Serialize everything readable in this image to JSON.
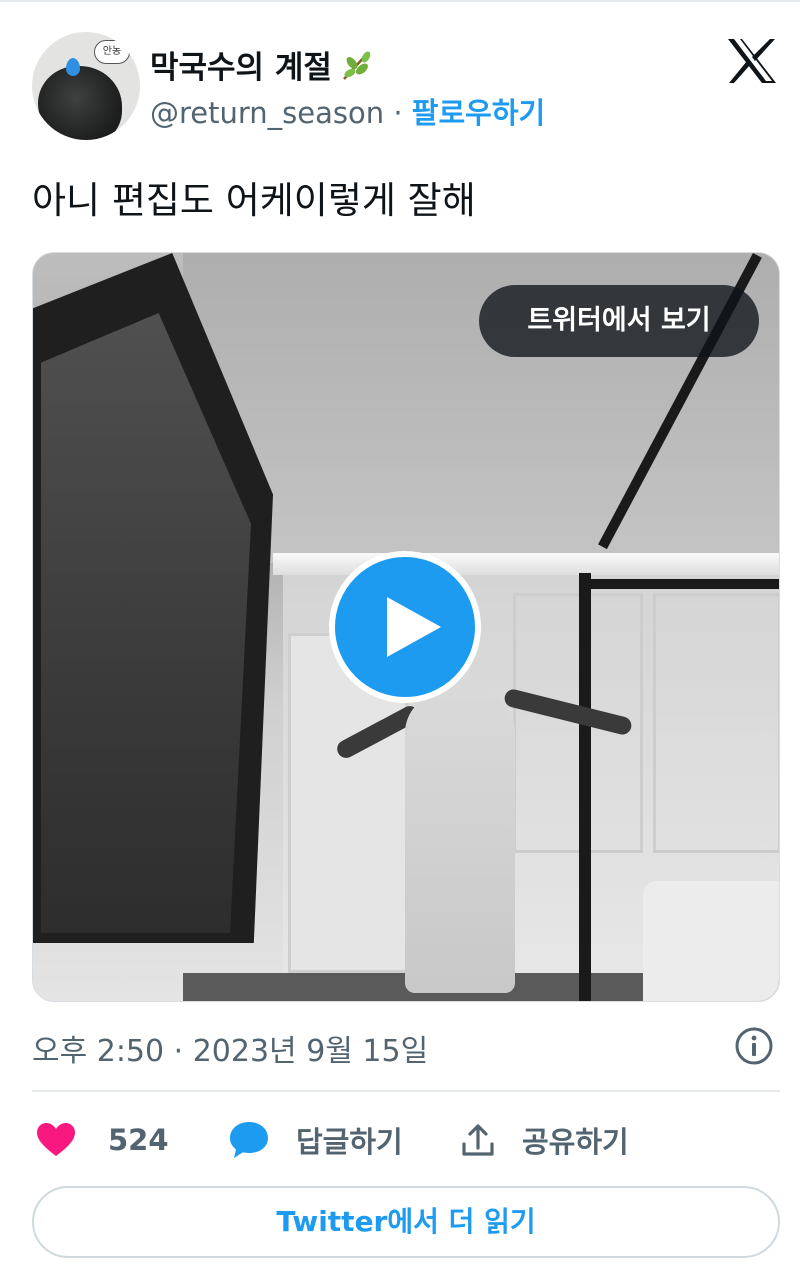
{
  "header": {
    "avatar_bubble_text": "안농",
    "display_name": "막국수의 계절",
    "name_emoji_icon": "leaf-branch-icon",
    "handle": "@return_season",
    "separator": "·",
    "follow_label": "팔로우하기",
    "logo_icon": "x-logo-icon"
  },
  "tweet": {
    "text": "아니 편집도 어케이렇게 잘해"
  },
  "media": {
    "view_on_twitter_label": "트위터에서 보기",
    "play_icon": "play-icon",
    "kind": "video"
  },
  "meta": {
    "timestamp": "오후 2:50 · 2023년 9월 15일",
    "info_icon": "info-icon"
  },
  "actions": {
    "like_count": "524",
    "like_icon": "heart-icon",
    "reply_label": "답글하기",
    "reply_icon": "speech-bubble-icon",
    "share_label": "공유하기",
    "share_icon": "share-upload-icon"
  },
  "footer": {
    "read_more_label": "Twitter에서 더 읽기"
  },
  "colors": {
    "accent": "#1d9bf0",
    "like": "#f91880",
    "text_primary": "#0f1419",
    "text_secondary": "#536471"
  }
}
